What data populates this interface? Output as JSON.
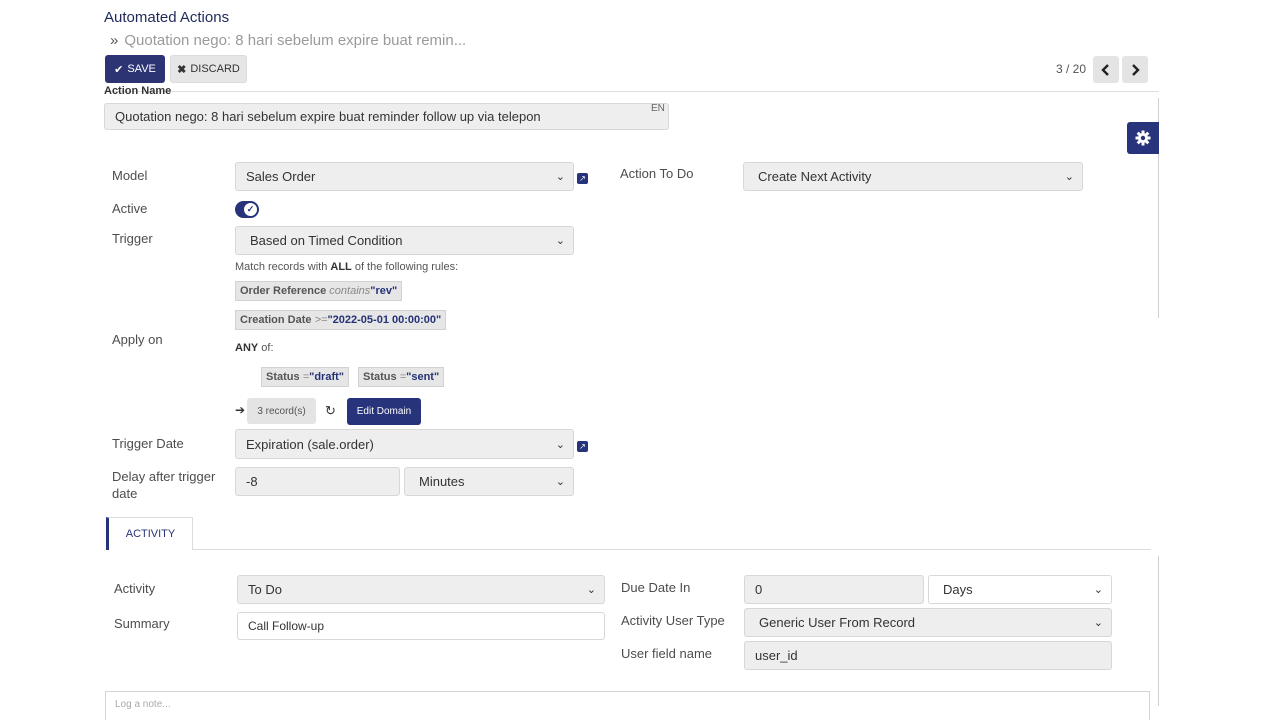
{
  "header": {
    "title": "Automated Actions",
    "breadcrumb": "Quotation nego: 8 hari sebelum expire buat remin...",
    "save_label": "SAVE",
    "discard_label": "DISCARD",
    "pager": "3 / 20"
  },
  "form": {
    "action_name_label": "Action Name",
    "action_name_value": "Quotation nego: 8 hari sebelum expire buat reminder follow up via telepon",
    "lang_badge": "EN",
    "model_label": "Model",
    "model_value": "Sales Order",
    "action_to_do_label": "Action To Do",
    "action_to_do_value": "Create Next Activity",
    "active_label": "Active",
    "active_value": true,
    "trigger_label": "Trigger",
    "trigger_value": "Based on Timed Condition",
    "apply_on_label": "Apply on",
    "domain_intro_pre": "Match records with",
    "domain_intro_bold": "ALL",
    "domain_intro_post": "of the following rules:",
    "rule1_field": "Order Reference",
    "rule1_op": "contains",
    "rule1_value": "\"rev\"",
    "rule2_field": "Creation Date",
    "rule2_op": ">=",
    "rule2_value": "\"2022-05-01 00:00:00\"",
    "any_bold": "ANY",
    "any_post": "of:",
    "rule3_field": "Status",
    "rule3_op": "=",
    "rule3_value": "\"draft\"",
    "rule4_field": "Status",
    "rule4_op": "=",
    "rule4_value": "\"sent\"",
    "records_count": "3 record(s)",
    "edit_domain_label": "Edit Domain",
    "trigger_date_label": "Trigger Date",
    "trigger_date_value": "Expiration (sale.order)",
    "delay_label": "Delay after trigger date",
    "delay_value": "-8",
    "delay_unit": "Minutes"
  },
  "activity_tab": {
    "tab_label": "ACTIVITY",
    "activity_label": "Activity",
    "activity_value": "To Do",
    "summary_label": "Summary",
    "summary_value": "Call Follow-up",
    "due_date_label": "Due Date In",
    "due_date_value": "0",
    "due_date_unit": "Days",
    "user_type_label": "Activity User Type",
    "user_type_value": "Generic User From Record",
    "user_field_label": "User field name",
    "user_field_value": "user_id"
  },
  "chatter": {
    "log_note_placeholder": "Log a note..."
  },
  "colors": {
    "primary": "#27337a",
    "field_bg": "#eeeeee"
  }
}
